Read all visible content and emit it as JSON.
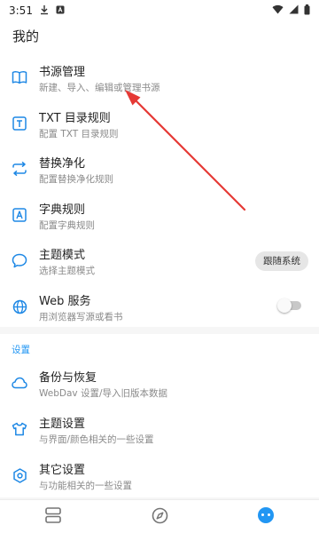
{
  "status_bar": {
    "time": "3:51"
  },
  "page": {
    "title": "我的"
  },
  "items": [
    {
      "title": "书源管理",
      "subtitle": "新建、导入、编辑或管理书源",
      "icon": "book-open-icon"
    },
    {
      "title": "TXT 目录规则",
      "subtitle": "配置 TXT 目录规则",
      "icon": "txt-box-icon"
    },
    {
      "title": "替换净化",
      "subtitle": "配置替换净化规则",
      "icon": "swap-arrows-icon"
    },
    {
      "title": "字典规则",
      "subtitle": "配置字典规则",
      "icon": "dictionary-box-icon"
    },
    {
      "title": "主题模式",
      "subtitle": "选择主题模式",
      "icon": "chat-bubble-icon",
      "chip": "跟随系统"
    },
    {
      "title": "Web 服务",
      "subtitle": "用浏览器写源或看书",
      "icon": "globe-icon",
      "toggle_on": false
    }
  ],
  "settings": {
    "header": "设置",
    "items": [
      {
        "title": "备份与恢复",
        "subtitle": "WebDav 设置/导入旧版本数据",
        "icon": "cloud-icon"
      },
      {
        "title": "主题设置",
        "subtitle": "与界面/颜色相关的一些设置",
        "icon": "tshirt-icon"
      },
      {
        "title": "其它设置",
        "subtitle": "与功能相关的一些设置",
        "icon": "settings-gear-icon"
      }
    ]
  },
  "bottom_nav": [
    {
      "icon": "bookshelf-icon",
      "active": false
    },
    {
      "icon": "compass-icon",
      "active": false
    },
    {
      "icon": "my-profile-icon",
      "active": true
    }
  ],
  "colors": {
    "accent": "#2196f3",
    "annotation_arrow": "#e53935"
  }
}
